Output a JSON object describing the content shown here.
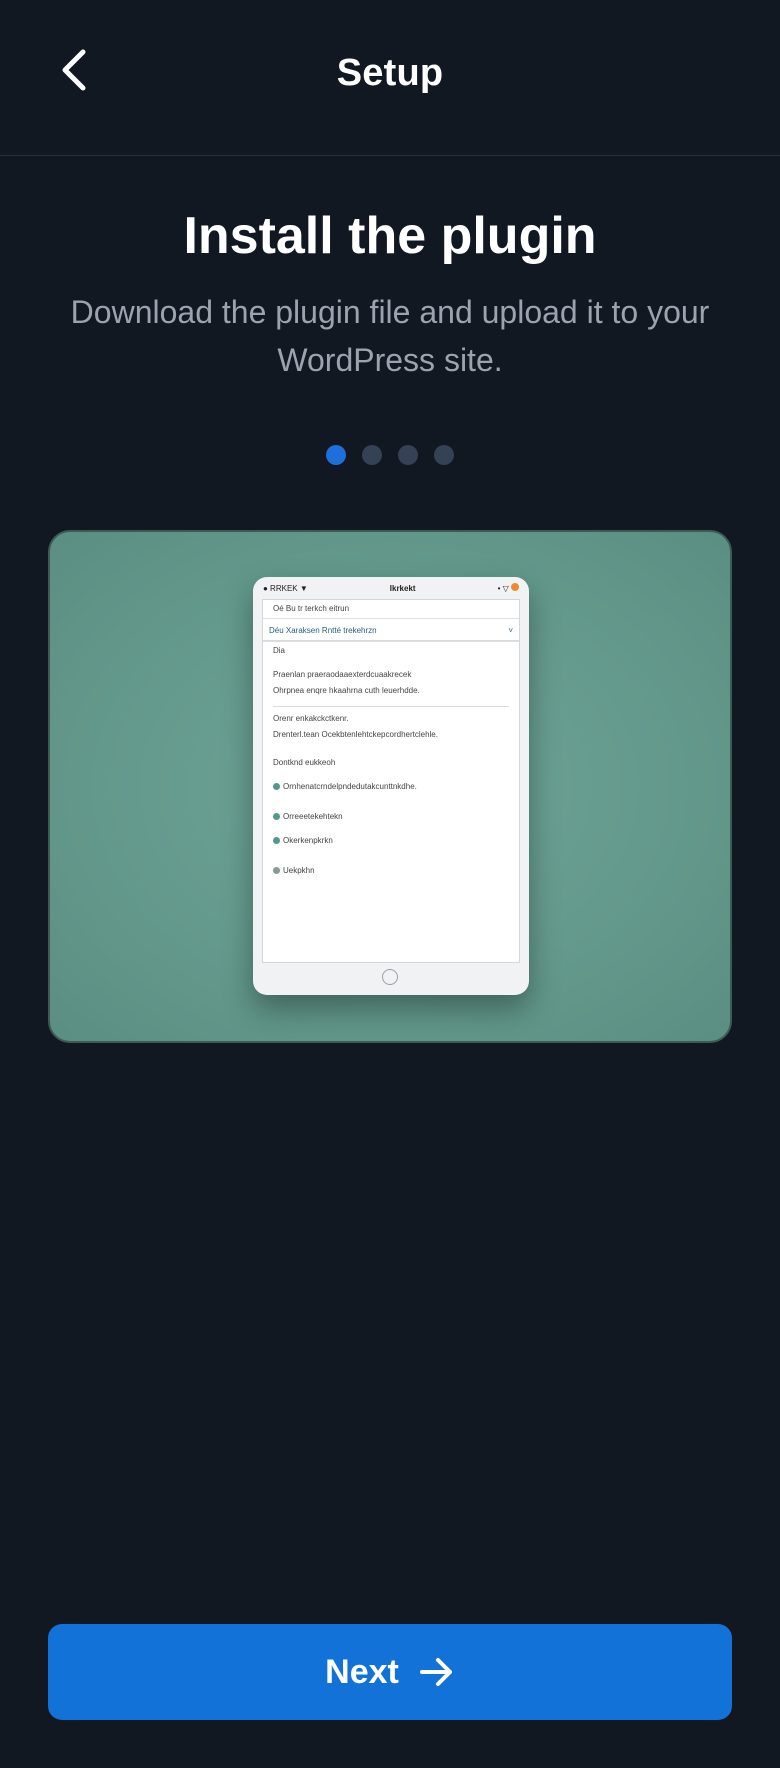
{
  "header": {
    "title": "Setup",
    "back_icon": "chevron-left-icon"
  },
  "step": {
    "title": "Install the plugin",
    "description": "Download the plugin file and upload it to your WordPress site.",
    "current_index": 1,
    "total": 4
  },
  "illustration": {
    "status_left": "● RRKEK ▼",
    "status_center": "Ikrkekt",
    "status_right": "• ▽",
    "line_top": "Oé  Bu tr terkch eitrun",
    "select_value": "Déu Xaraksen Rntté trekehrzn",
    "select_chevron": "˅",
    "label_1": "Dia",
    "para_1a": "Praenlan praeraodaaexterdcuaakrecek",
    "para_1b": "Ohrpnea enqre hkaahrna cuth leuerhdde.",
    "para_2a": "Orenr enkakckctkenr.",
    "para_2b": "Drenterl.tean Ocekbtenlehtckepcordhertclehle.",
    "section_label": "Dontknd eukkeoh",
    "check_1": "Ornhenatcrndelpndedutakcunttnkdhe.",
    "check_2": "Orreeetekehtekn",
    "check_3": "Okerkenpkrkn",
    "check_4": "Uekpkhn"
  },
  "footer": {
    "next_label": "Next",
    "next_icon": "arrow-right-icon"
  },
  "colors": {
    "background": "#111822",
    "accent": "#1372d8",
    "active_dot": "#1e6fd9",
    "inactive_dot": "#354154",
    "illustration_bg": "#649a8d"
  }
}
